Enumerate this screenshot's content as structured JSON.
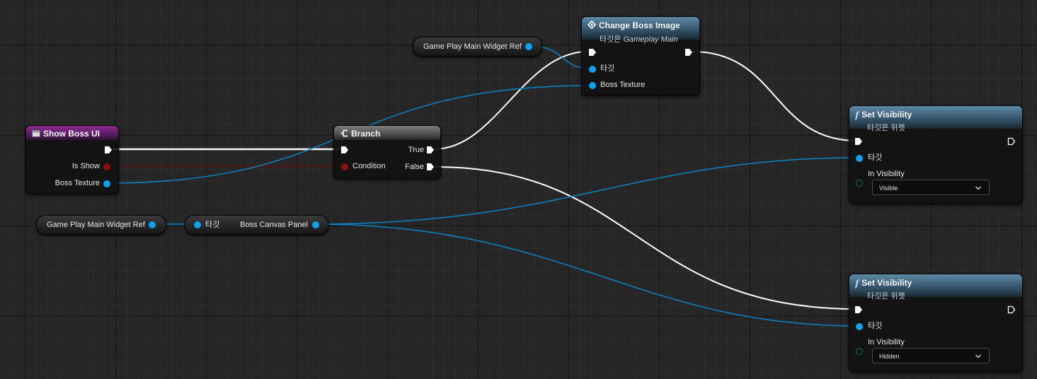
{
  "nodes": {
    "show_boss_ui": {
      "title": "Show Boss UI",
      "pins": {
        "is_show": "Is Show",
        "boss_texture": "Boss Texture"
      }
    },
    "branch": {
      "title": "Branch",
      "pins": {
        "condition": "Condition",
        "true_label": "True",
        "false_label": "False"
      }
    },
    "change_boss_image": {
      "title": "Change Boss Image",
      "subtitle_prefix": "타깃은",
      "subtitle_target": "Gameplay Main",
      "pins": {
        "target": "타깃",
        "boss_texture": "Boss Texture"
      }
    },
    "widget_ref_top": {
      "label": "Game Play Main Widget Ref"
    },
    "widget_ref_left": {
      "label": "Game Play Main Widget Ref"
    },
    "get_canvas": {
      "target": "타깃",
      "output": "Boss Canvas Panel"
    },
    "set_visibility_visible": {
      "title": "Set Visibility",
      "subtitle": "타깃은 위젯",
      "pins": {
        "target": "타깃",
        "in_visibility": "In Visibility"
      },
      "value": "Visible"
    },
    "set_visibility_hidden": {
      "title": "Set Visibility",
      "subtitle": "타깃은 위젯",
      "pins": {
        "target": "타깃",
        "in_visibility": "In Visibility"
      },
      "value": "Hidden"
    }
  },
  "colors": {
    "exec_wire": "#ffffff",
    "object_wire": "#0a86c9",
    "bool_wire": "#6e0a0a",
    "object_pin": "#0ea0ec",
    "bool_pin": "#8c0f0f",
    "event_header": "#8c2a8f",
    "function_header": "#5e8aa6"
  },
  "icons": {
    "event": "event-node-icon",
    "branch": "branch-icon",
    "macro": "diamond-icon",
    "function": "function-icon",
    "exec": "exec-pin-icon",
    "dropdown": "chevron-down-icon"
  }
}
